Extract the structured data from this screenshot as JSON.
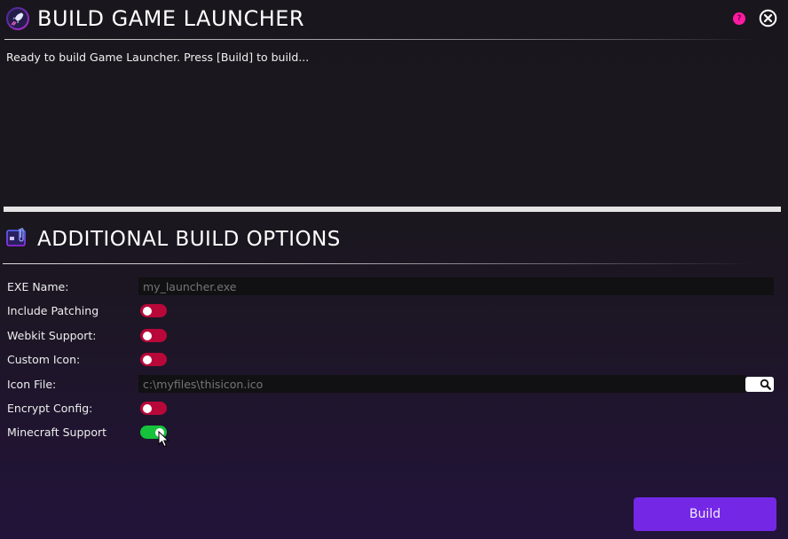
{
  "header": {
    "title": "BUILD GAME LAUNCHER",
    "app_icon": "rocket-icon",
    "help_icon": "help-icon",
    "help_glyph": "?",
    "close_icon": "close-circle-icon"
  },
  "status": {
    "message": "Ready to build Game Launcher. Press [Build] to build..."
  },
  "options": {
    "title": "ADDITIONAL BUILD OPTIONS",
    "icon": "build-options-icon",
    "rows": [
      {
        "label": "EXE Name:",
        "type": "text",
        "placeholder": "my_launcher.exe",
        "value": ""
      },
      {
        "label": "Include Patching",
        "type": "toggle",
        "on": false
      },
      {
        "label": "Webkit Support:",
        "type": "toggle",
        "on": false
      },
      {
        "label": "Custom Icon:",
        "type": "toggle",
        "on": false
      },
      {
        "label": "Icon File:",
        "type": "file",
        "placeholder": "c:\\myfiles\\thisicon.ico",
        "value": "",
        "browse_icon": "search-icon"
      },
      {
        "label": "Encrypt Config:",
        "type": "toggle",
        "on": false
      },
      {
        "label": "Minecraft Support",
        "type": "toggle",
        "on": true
      }
    ]
  },
  "actions": {
    "build_label": "Build"
  },
  "colors": {
    "accent": "#7428e6",
    "toggle_off": "#b8083a",
    "toggle_on": "#16c23c",
    "help": "#ff1aa3"
  }
}
